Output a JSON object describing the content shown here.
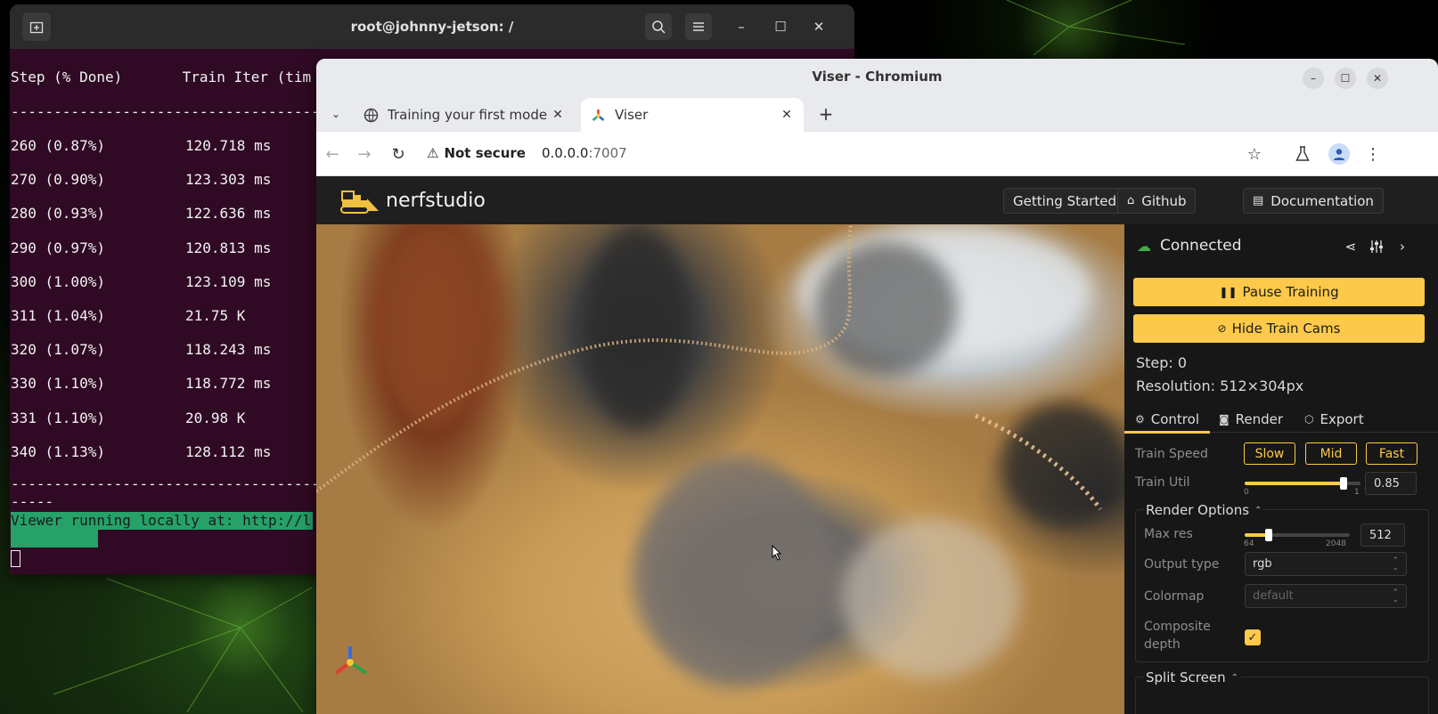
{
  "desktop": {},
  "terminal": {
    "title": "root@johnny-jetson: /",
    "header": "Step (% Done)       Train Iter (tim",
    "separator": "------------------------------------",
    "rows": [
      {
        "step": "260 (0.87%)",
        "iter": "120.718 ms"
      },
      {
        "step": "270 (0.90%)",
        "iter": "123.303 ms"
      },
      {
        "step": "280 (0.93%)",
        "iter": "122.636 ms"
      },
      {
        "step": "290 (0.97%)",
        "iter": "120.813 ms"
      },
      {
        "step": "300 (1.00%)",
        "iter": "123.109 ms"
      },
      {
        "step": "311 (1.04%)",
        "iter": "21.75 K"
      },
      {
        "step": "320 (1.07%)",
        "iter": "118.243 ms"
      },
      {
        "step": "330 (1.10%)",
        "iter": "118.772 ms"
      },
      {
        "step": "331 (1.10%)",
        "iter": "20.98 K"
      },
      {
        "step": "340 (1.13%)",
        "iter": "128.112 ms"
      }
    ],
    "separator2": "------------------------------------",
    "separator3": "-----",
    "viewer_line": "Viewer running locally at: http://l"
  },
  "browser": {
    "window_title": "Viser - Chromium",
    "tabs": [
      {
        "label": "Training your first model",
        "icon": "globe-icon"
      },
      {
        "label": "Viser",
        "icon": "viser-icon"
      }
    ],
    "security_label": "Not secure",
    "url_host": "0.0.0.0",
    "url_port": ":7007"
  },
  "nerfstudio": {
    "logo_text": "nerfstudio",
    "header_buttons": {
      "getting_started": "Getting Started",
      "github": "Github",
      "documentation": "Documentation"
    },
    "panel": {
      "status": "Connected",
      "pause_training": "Pause Training",
      "hide_train_cams": "Hide Train Cams",
      "step": "Step: 0",
      "resolution": "Resolution: 512×304px",
      "tabs": [
        "Control",
        "Render",
        "Export"
      ],
      "train_speed_label": "Train Speed",
      "speed_options": [
        "Slow",
        "Mid",
        "Fast"
      ],
      "train_util_label": "Train Util",
      "train_util_value": "0.85",
      "train_util_fraction": 0.85,
      "train_util_min": "0",
      "train_util_max": "1",
      "render_options_title": "Render Options",
      "max_res_label": "Max res",
      "max_res_value": "512",
      "max_res_min": "64",
      "max_res_max": "2048",
      "output_type_label": "Output type",
      "output_type_value": "rgb",
      "colormap_label": "Colormap",
      "colormap_value": "default",
      "composite_depth_label": "Composite depth",
      "composite_depth_checked": true,
      "split_screen_title": "Split Screen"
    }
  },
  "colors": {
    "accent": "#fcc94a",
    "terminal_bg": "#300a24",
    "connected": "#3fae4a"
  }
}
